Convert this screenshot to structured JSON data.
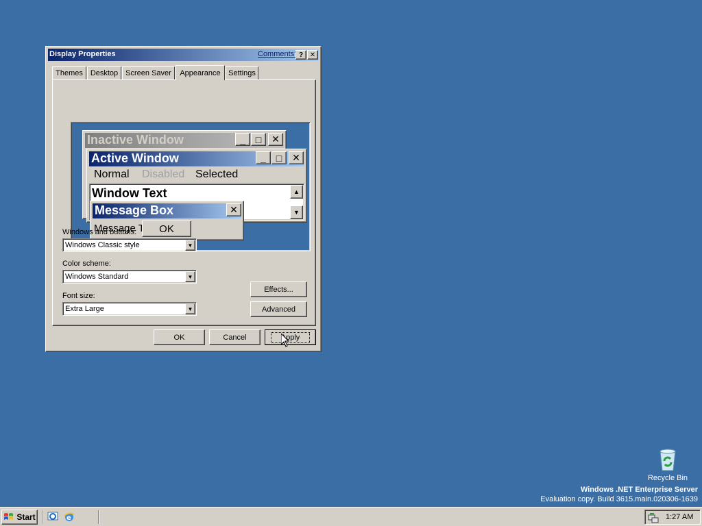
{
  "dialog": {
    "title": "Display Properties",
    "comments_link": "Comments?",
    "help_glyph": "?",
    "close_glyph": "✕",
    "tabs": [
      {
        "label": "Themes"
      },
      {
        "label": "Desktop"
      },
      {
        "label": "Screen Saver"
      },
      {
        "label": "Appearance"
      },
      {
        "label": "Settings"
      }
    ],
    "active_tab": "Appearance",
    "preview": {
      "inactive_title": "Inactive Window",
      "active_title": "Active Window",
      "menu_normal": "Normal",
      "menu_disabled": "Disabled",
      "menu_selected": "Selected",
      "window_text": "Window Text",
      "msgbox_title": "Message Box",
      "msgbox_text": "Message Text",
      "msgbox_ok": "OK",
      "min_glyph": "_",
      "max_glyph": "□",
      "close_glyph": "✕",
      "scroll_up_glyph": "▲",
      "scroll_down_glyph": "▼"
    },
    "windows_buttons_label": "Windows and buttons:",
    "windows_buttons_value": "Windows Classic style",
    "color_scheme_label": "Color scheme:",
    "color_scheme_value": "Windows Standard",
    "font_size_label": "Font size:",
    "font_size_value": "Extra Large",
    "combo_arrow_glyph": "▼",
    "effects_label": "Effects...",
    "advanced_label": "Advanced",
    "ok_label": "OK",
    "cancel_label": "Cancel",
    "apply_label": "Apply"
  },
  "desktop": {
    "recycle_bin_label": "Recycle Bin",
    "watermark_line1": "Windows .NET Enterprise Server",
    "watermark_line2": "Evaluation copy. Build 3615.main.020306-1639"
  },
  "taskbar": {
    "start_label": "Start",
    "clock": "1:27 AM"
  },
  "colors": {
    "desktop": "#3a6ea5",
    "face": "#d4d0c8",
    "active_title_start": "#0a246a",
    "active_title_end": "#a6caf0",
    "inactive_title_start": "#808080",
    "inactive_title_end": "#c0c0c0"
  }
}
